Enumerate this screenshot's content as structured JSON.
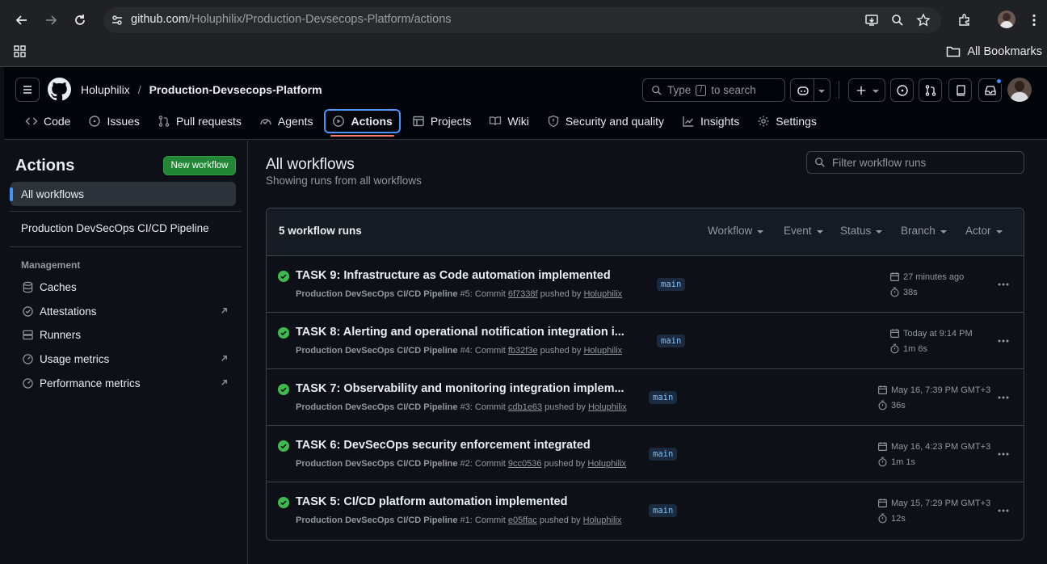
{
  "browser": {
    "url_host": "github.com",
    "url_path": "/Holuphilix/Production-Devsecops-Platform/actions",
    "bookmarks_label": "All Bookmarks"
  },
  "header": {
    "owner": "Holuphilix",
    "separator": "/",
    "repo": "Production-Devsecops-Platform",
    "search_prefix": "Type",
    "search_key": "/",
    "search_suffix": "to search"
  },
  "tabs": [
    {
      "label": "Code",
      "icon": "code-icon"
    },
    {
      "label": "Issues",
      "icon": "issue-icon"
    },
    {
      "label": "Pull requests",
      "icon": "pull-request-icon"
    },
    {
      "label": "Agents",
      "icon": "agents-icon"
    },
    {
      "label": "Actions",
      "icon": "play-icon",
      "active": true
    },
    {
      "label": "Projects",
      "icon": "table-icon"
    },
    {
      "label": "Wiki",
      "icon": "book-icon"
    },
    {
      "label": "Security and quality",
      "icon": "shield-icon"
    },
    {
      "label": "Insights",
      "icon": "graph-icon"
    },
    {
      "label": "Settings",
      "icon": "gear-icon"
    }
  ],
  "sidebar": {
    "title": "Actions",
    "new_workflow": "New workflow",
    "all_workflows": "All workflows",
    "pipeline": "Production DevSecOps CI/CD Pipeline",
    "management_label": "Management",
    "items": [
      {
        "label": "Caches",
        "icon": "database-icon",
        "external": false
      },
      {
        "label": "Attestations",
        "icon": "verified-icon",
        "external": true
      },
      {
        "label": "Runners",
        "icon": "server-icon",
        "external": false
      },
      {
        "label": "Usage metrics",
        "icon": "meter-icon",
        "external": true
      },
      {
        "label": "Performance metrics",
        "icon": "meter-icon",
        "external": true
      }
    ]
  },
  "main": {
    "title": "All workflows",
    "subtitle": "Showing runs from all workflows",
    "filter_placeholder": "Filter workflow runs",
    "runs_count": "5 workflow runs",
    "filters": [
      "Workflow",
      "Event",
      "Status",
      "Branch",
      "Actor"
    ],
    "runs": [
      {
        "title": "TASK 9: Infrastructure as Code automation implemented",
        "workflow": "Production DevSecOps CI/CD Pipeline",
        "meta": "#5: Commit",
        "commit": "6f7338f",
        "pushed_by": "pushed by",
        "user": "Holuphilix",
        "branch": "main",
        "time": "27 minutes ago",
        "duration": "38s",
        "status": "success"
      },
      {
        "title": "TASK 8: Alerting and operational notification integration i...",
        "workflow": "Production DevSecOps CI/CD Pipeline",
        "meta": "#4: Commit",
        "commit": "fb32f3e",
        "pushed_by": "pushed by",
        "user": "Holuphilix",
        "branch": "main",
        "time": "Today at 9:14 PM",
        "duration": "1m 6s",
        "status": "success"
      },
      {
        "title": "TASK 7: Observability and monitoring integration implem...",
        "workflow": "Production DevSecOps CI/CD Pipeline",
        "meta": "#3: Commit",
        "commit": "cdb1e63",
        "pushed_by": "pushed by",
        "user": "Holuphilix",
        "branch": "main",
        "time": "May 16, 7:39 PM GMT+3",
        "duration": "36s",
        "status": "success"
      },
      {
        "title": "TASK 6: DevSecOps security enforcement integrated",
        "workflow": "Production DevSecOps CI/CD Pipeline",
        "meta": "#2: Commit",
        "commit": "9cc0536",
        "pushed_by": "pushed by",
        "user": "Holuphilix",
        "branch": "main",
        "time": "May 16, 4:23 PM GMT+3",
        "duration": "1m 1s",
        "status": "success"
      },
      {
        "title": "TASK 5: CI/CD platform automation implemented",
        "workflow": "Production DevSecOps CI/CD Pipeline",
        "meta": "#1: Commit",
        "commit": "e05ffac",
        "pushed_by": "pushed by",
        "user": "Holuphilix",
        "branch": "main",
        "time": "May 15, 7:29 PM GMT+3",
        "duration": "12s",
        "status": "success"
      }
    ]
  },
  "colors": {
    "success": "#3fb950",
    "accent": "#4493f8",
    "primary_button": "#238636",
    "tab_underline": "#f78166"
  }
}
